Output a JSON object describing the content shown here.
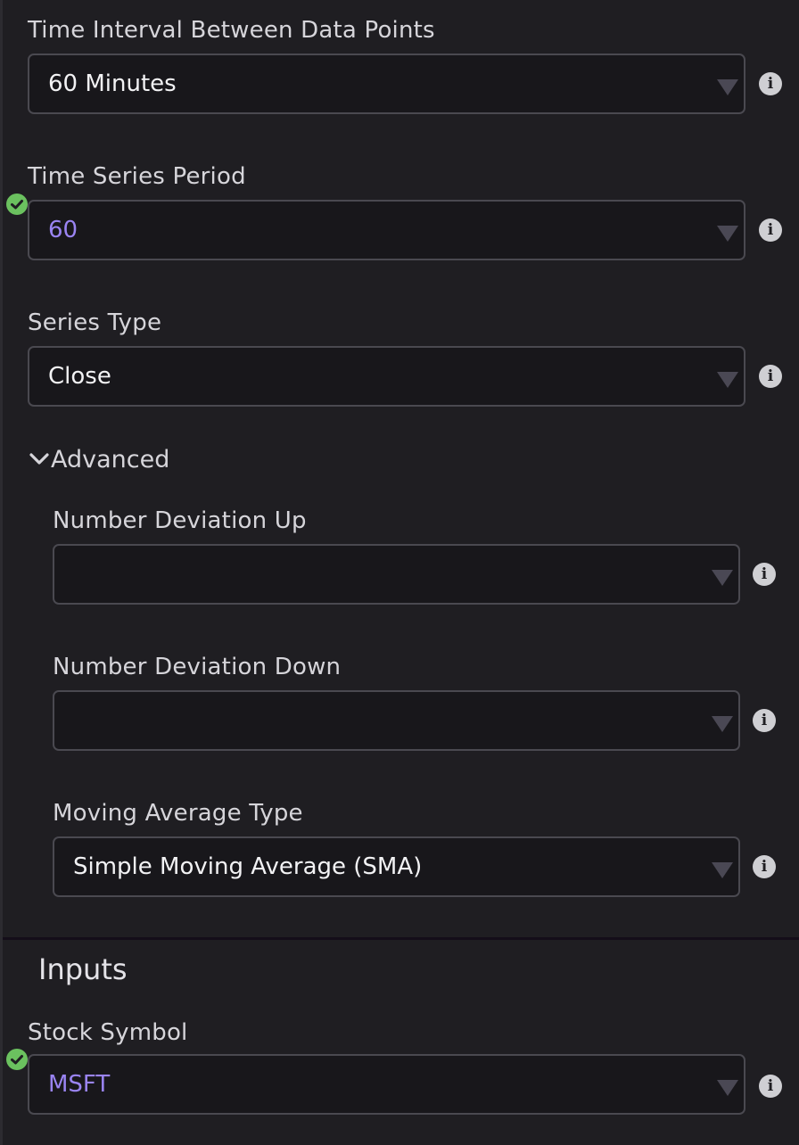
{
  "fields": {
    "interval": {
      "label": "Time Interval Between Data Points",
      "value": "60 Minutes"
    },
    "period": {
      "label": "Time Series Period",
      "value": "60"
    },
    "series_type": {
      "label": "Series Type",
      "value": "Close"
    },
    "deviation_up": {
      "label": "Number Deviation Up",
      "value": ""
    },
    "deviation_down": {
      "label": "Number Deviation Down",
      "value": ""
    },
    "ma_type": {
      "label": "Moving Average Type",
      "value": "Simple Moving Average (SMA)"
    },
    "symbol": {
      "label": "Stock Symbol",
      "value": "MSFT"
    }
  },
  "advanced": {
    "label": "Advanced",
    "expanded": true
  },
  "inputs_section": {
    "title": "Inputs"
  },
  "info_glyph": "i",
  "colors": {
    "background": "#1f1e22",
    "field_bg": "#18171b",
    "field_border": "#4a4950",
    "accent_text": "#9a84f2",
    "valid_check": "#6bc15f",
    "info_icon": "#cfcfd3"
  },
  "icons": [
    "chevron-down-icon",
    "info-icon",
    "check-circle-icon",
    "caret-down-icon"
  ]
}
